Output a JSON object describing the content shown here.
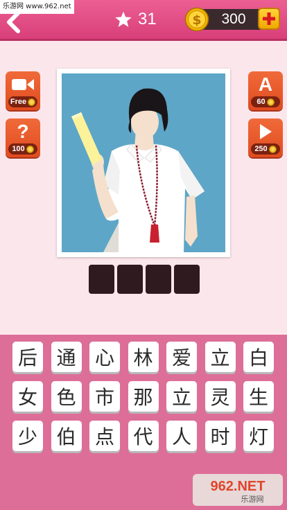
{
  "watermark": "乐游网 www.962.net",
  "header": {
    "level": "31",
    "coins": "300",
    "icons": [
      "back-arrow-icon",
      "star-icon",
      "coin-icon",
      "plus-icon"
    ]
  },
  "hints": {
    "video": {
      "icon": "video-camera-icon",
      "label": "Free"
    },
    "question": {
      "icon": "question-mark-icon",
      "cost": "100"
    },
    "letter": {
      "icon": "letter-a-icon",
      "letter": "A",
      "cost": "60"
    },
    "skip": {
      "icon": "play-arrow-icon",
      "cost": "250"
    }
  },
  "puzzle": {
    "image": "silhouette-person-white-shirt-necklace",
    "answer_length": 4
  },
  "letters": [
    [
      "后",
      "通",
      "心",
      "林",
      "爱",
      "立",
      "白"
    ],
    [
      "女",
      "色",
      "市",
      "那",
      "立",
      "灵",
      "生"
    ],
    [
      "少",
      "伯",
      "点",
      "代",
      "人",
      "时",
      "灯"
    ]
  ],
  "logo": {
    "text": "962.NET",
    "subtext": "乐游网"
  },
  "colors": {
    "topbar": "#e24f86",
    "background": "#fbe6ec",
    "board": "#dd6e98",
    "hint_button": "#e8562a",
    "slot": "#2f1a1f"
  }
}
